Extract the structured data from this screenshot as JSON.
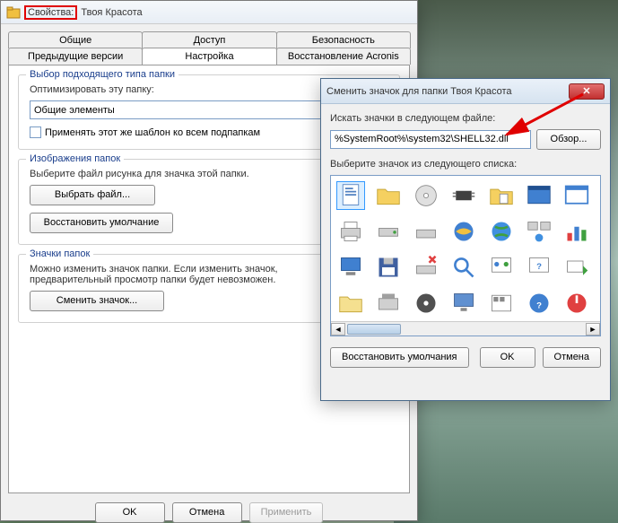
{
  "props_window": {
    "title_prefix": "Свойства:",
    "title_name": "Твоя Красота",
    "tabs_row1": [
      {
        "label": "Общие"
      },
      {
        "label": "Доступ"
      },
      {
        "label": "Безопасность"
      }
    ],
    "tabs_row2": [
      {
        "label": "Предыдущие версии"
      },
      {
        "label": "Настройка"
      },
      {
        "label": "Восстановление Acronis"
      }
    ],
    "group_type": {
      "title": "Выбор подходящего типа папки",
      "optimize_label": "Оптимизировать эту папку:",
      "combo_value": "Общие элементы",
      "apply_subfolders": "Применять этот же шаблон ко всем подпапкам"
    },
    "group_images": {
      "title": "Изображения папок",
      "desc": "Выберите файл рисунка для значка этой папки.",
      "choose_file": "Выбрать файл...",
      "restore": "Восстановить умолчание"
    },
    "group_icons": {
      "title": "Значки папок",
      "desc": "Можно изменить значок папки. Если изменить значок, предварительный просмотр папки будет невозможен.",
      "change_icon": "Сменить значок..."
    },
    "ok": "OK",
    "cancel": "Отмена",
    "apply": "Применить"
  },
  "icon_window": {
    "title": "Сменить значок для папки Твоя Красота",
    "search_label": "Искать значки в следующем файле:",
    "path_value": "%SystemRoot%\\system32\\SHELL32.dll",
    "browse": "Обзор...",
    "select_label": "Выберите значок из следующего списка:",
    "restore_defaults": "Восстановить умолчания",
    "ok": "OK",
    "cancel": "Отмена"
  }
}
